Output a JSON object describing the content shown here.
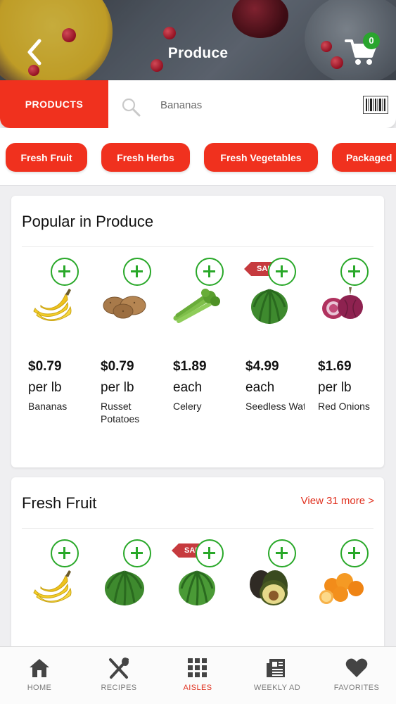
{
  "header": {
    "title": "Produce",
    "cart_count": "0"
  },
  "search": {
    "products_label": "PRODUCTS",
    "value": "Bananas"
  },
  "categories": [
    "Fresh Fruit",
    "Fresh Herbs",
    "Fresh Vegetables",
    "Packaged"
  ],
  "popular": {
    "title": "Popular in Produce",
    "items": [
      {
        "price": "$0.79",
        "unit": "per lb",
        "name": "Bananas",
        "sale": false,
        "image": "banana-icon"
      },
      {
        "price": "$0.79",
        "unit": "per lb",
        "name": "Russet Potatoes",
        "sale": false,
        "image": "potato-icon"
      },
      {
        "price": "$1.89",
        "unit": "each",
        "name": "Celery",
        "sale": false,
        "image": "celery-icon"
      },
      {
        "price": "$4.99",
        "unit": "each",
        "name": "Seedless Watermelon",
        "sale": true,
        "sale_label": "SALE",
        "image": "watermelon-icon"
      },
      {
        "price": "$1.69",
        "unit": "per lb",
        "name": "Red Onions",
        "sale": false,
        "image": "onion-icon"
      }
    ]
  },
  "fresh_fruit": {
    "title": "Fresh Fruit",
    "view_more": "View 31 more >",
    "items": [
      {
        "image": "banana-icon",
        "sale": false
      },
      {
        "image": "watermelon-icon",
        "sale": false
      },
      {
        "image": "watermelon-icon",
        "sale": true,
        "sale_label": "SALE"
      },
      {
        "image": "avocado-icon",
        "sale": false
      },
      {
        "image": "orange-icon",
        "sale": false
      }
    ]
  },
  "nav": [
    {
      "label": "HOME",
      "icon": "home-icon",
      "active": false
    },
    {
      "label": "RECIPES",
      "icon": "utensils-icon",
      "active": false
    },
    {
      "label": "AISLES",
      "icon": "grid-icon",
      "active": true
    },
    {
      "label": "WEEKLY AD",
      "icon": "newspaper-icon",
      "active": false
    },
    {
      "label": "FAVORITES",
      "icon": "heart-icon",
      "active": false
    }
  ],
  "colors": {
    "accent": "#f0311e",
    "add_green": "#29a829",
    "sale_red": "#c63a3e",
    "active_nav": "#e0301e"
  }
}
